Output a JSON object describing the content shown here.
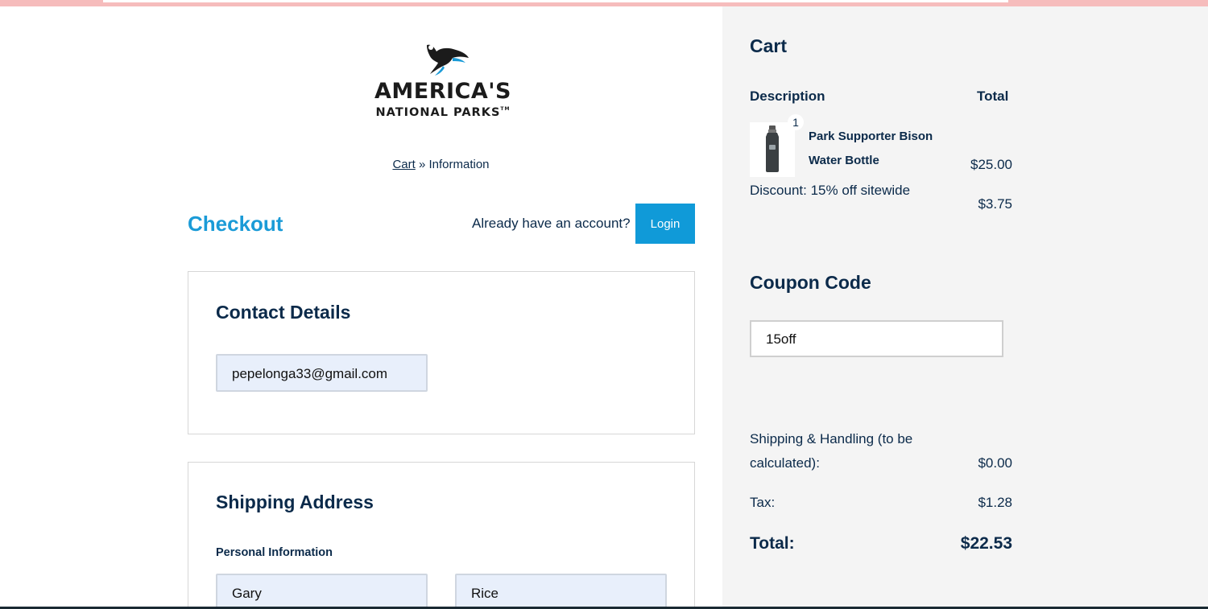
{
  "logo": {
    "line1": "AMERICA'S",
    "line2": "NATIONAL PARKS",
    "trademark": "TM",
    "icon": "eagle-icon"
  },
  "breadcrumb": {
    "cart": "Cart",
    "separator": "»",
    "current": "Information"
  },
  "checkout": {
    "title": "Checkout",
    "account_prompt": "Already have an account?",
    "login_label": "Login"
  },
  "contact": {
    "title": "Contact Details",
    "email_value": "pepelonga33@gmail.com"
  },
  "shipping": {
    "title": "Shipping Address",
    "personal_info_label": "Personal Information",
    "first_name_value": "Gary",
    "last_name_value": "Rice"
  },
  "cart": {
    "title": "Cart",
    "col_description": "Description",
    "col_total": "Total",
    "item": {
      "name": "Park Supporter Bison Water Bottle",
      "quantity": "1",
      "price": "$25.00",
      "thumbnail_icon": "water-bottle-icon"
    },
    "discount_label": "Discount: 15% off sitewide",
    "discount_value": "$3.75"
  },
  "coupon": {
    "title": "Coupon Code",
    "value": "15off"
  },
  "summary": {
    "shipping_label": "Shipping & Handling (to be calculated):",
    "shipping_value": "$0.00",
    "tax_label": "Tax:",
    "tax_value": "$1.28",
    "total_label": "Total:",
    "total_value": "$22.53"
  },
  "colors": {
    "accent": "#1b9bd7",
    "button": "#109ad8",
    "text": "#0b2a4a",
    "sidebar_bg": "#f4f4f4",
    "field_bg": "#e8effb"
  }
}
